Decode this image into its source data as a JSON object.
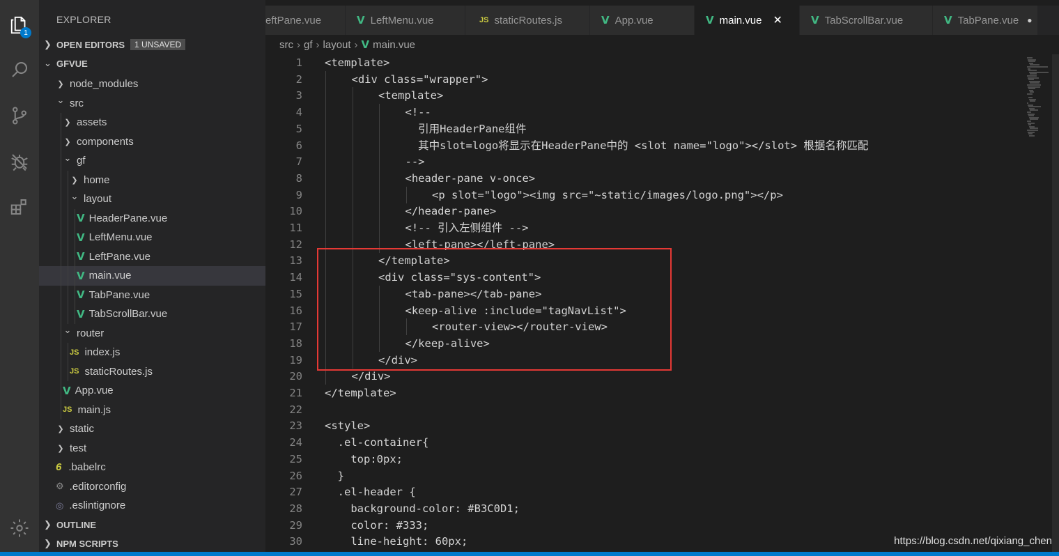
{
  "activity_bar": {
    "icons": [
      "explorer-icon",
      "search-icon",
      "source-control-icon",
      "debug-icon",
      "extensions-icon",
      "settings-gear-icon"
    ],
    "explorer_badge": "1"
  },
  "sidebar": {
    "title": "EXPLORER",
    "open_editors": {
      "label": "OPEN EDITORS",
      "badge": "1 UNSAVED"
    },
    "project": {
      "label": "GFVUE"
    },
    "tree": [
      {
        "label": "node_modules",
        "kind": "folder-closed",
        "depth": 0
      },
      {
        "label": "src",
        "kind": "folder-open",
        "depth": 0
      },
      {
        "label": "assets",
        "kind": "folder-closed",
        "depth": 1
      },
      {
        "label": "components",
        "kind": "folder-closed",
        "depth": 1
      },
      {
        "label": "gf",
        "kind": "folder-open",
        "depth": 1
      },
      {
        "label": "home",
        "kind": "folder-closed",
        "depth": 2
      },
      {
        "label": "layout",
        "kind": "folder-open",
        "depth": 2
      },
      {
        "label": "HeaderPane.vue",
        "kind": "vue",
        "depth": 3
      },
      {
        "label": "LeftMenu.vue",
        "kind": "vue",
        "depth": 3
      },
      {
        "label": "LeftPane.vue",
        "kind": "vue",
        "depth": 3
      },
      {
        "label": "main.vue",
        "kind": "vue",
        "depth": 3,
        "selected": true
      },
      {
        "label": "TabPane.vue",
        "kind": "vue",
        "depth": 3
      },
      {
        "label": "TabScrollBar.vue",
        "kind": "vue",
        "depth": 3
      },
      {
        "label": "router",
        "kind": "folder-open",
        "depth": 1
      },
      {
        "label": "index.js",
        "kind": "js",
        "depth": 2
      },
      {
        "label": "staticRoutes.js",
        "kind": "js",
        "depth": 2
      },
      {
        "label": "App.vue",
        "kind": "vue",
        "depth": 1
      },
      {
        "label": "main.js",
        "kind": "js",
        "depth": 1
      },
      {
        "label": "static",
        "kind": "folder-closed",
        "depth": 0
      },
      {
        "label": "test",
        "kind": "folder-closed",
        "depth": 0
      },
      {
        "label": ".babelrc",
        "kind": "babel",
        "depth": 0
      },
      {
        "label": ".editorconfig",
        "kind": "gear",
        "depth": 0
      },
      {
        "label": ".eslintignore",
        "kind": "eslint",
        "depth": 0
      }
    ],
    "outline": {
      "label": "OUTLINE"
    },
    "npm_scripts": {
      "label": "NPM SCRIPTS"
    }
  },
  "tabs": [
    {
      "label": "eftPane.vue",
      "kind": "vue-cut"
    },
    {
      "label": "LeftMenu.vue",
      "kind": "vue"
    },
    {
      "label": "staticRoutes.js",
      "kind": "js"
    },
    {
      "label": "App.vue",
      "kind": "vue"
    },
    {
      "label": "main.vue",
      "kind": "vue",
      "active": true,
      "close": "✕"
    },
    {
      "label": "TabScrollBar.vue",
      "kind": "vue"
    },
    {
      "label": "TabPane.vue",
      "kind": "vue",
      "unsaved": "●"
    }
  ],
  "breadcrumb": [
    "src",
    "gf",
    "layout",
    "main.vue"
  ],
  "editor": {
    "lines": [
      {
        "n": "1",
        "indent": 0,
        "text": "<template>"
      },
      {
        "n": "2",
        "indent": 1,
        "text": "<div class=\"wrapper\">"
      },
      {
        "n": "3",
        "indent": 2,
        "text": "<template>"
      },
      {
        "n": "4",
        "indent": 3,
        "text": "<!--"
      },
      {
        "n": "5",
        "indent": 3,
        "text": "  引用HeaderPane组件"
      },
      {
        "n": "6",
        "indent": 3,
        "text": "  其中slot=logo将显示在HeaderPane中的 <slot name=\"logo\"></slot> 根据名称匹配"
      },
      {
        "n": "7",
        "indent": 3,
        "text": "-->"
      },
      {
        "n": "8",
        "indent": 3,
        "text": "<header-pane v-once>"
      },
      {
        "n": "9",
        "indent": 4,
        "text": "<p slot=\"logo\"><img src=\"~static/images/logo.png\"></p>"
      },
      {
        "n": "10",
        "indent": 3,
        "text": "</header-pane>"
      },
      {
        "n": "11",
        "indent": 3,
        "text": "<!-- 引入左侧组件 -->"
      },
      {
        "n": "12",
        "indent": 3,
        "text": "<left-pane></left-pane>"
      },
      {
        "n": "13",
        "indent": 2,
        "text": "</template>"
      },
      {
        "n": "14",
        "indent": 2,
        "text": "<div class=\"sys-content\">"
      },
      {
        "n": "15",
        "indent": 3,
        "text": "<tab-pane></tab-pane>"
      },
      {
        "n": "16",
        "indent": 3,
        "text": "<keep-alive :include=\"tagNavList\">"
      },
      {
        "n": "17",
        "indent": 4,
        "text": "<router-view></router-view>"
      },
      {
        "n": "18",
        "indent": 3,
        "text": "</keep-alive>"
      },
      {
        "n": "19",
        "indent": 2,
        "text": "</div>"
      },
      {
        "n": "20",
        "indent": 1,
        "text": "</div>"
      },
      {
        "n": "21",
        "indent": 0,
        "text": "</template>"
      },
      {
        "n": "22",
        "indent": 0,
        "text": ""
      },
      {
        "n": "23",
        "indent": 0,
        "text": "<style>"
      },
      {
        "n": "24",
        "indent": 0,
        "text": "  .el-container{"
      },
      {
        "n": "25",
        "indent": 0,
        "text": "    top:0px;"
      },
      {
        "n": "26",
        "indent": 0,
        "text": "  }"
      },
      {
        "n": "27",
        "indent": 0,
        "text": "  .el-header {"
      },
      {
        "n": "28",
        "indent": 0,
        "text": "    background-color: #B3C0D1;"
      },
      {
        "n": "29",
        "indent": 0,
        "text": "    color: #333;"
      },
      {
        "n": "30",
        "indent": 0,
        "text": "    line-height: 60px;"
      }
    ]
  },
  "watermark": "https://blog.csdn.net/qixiang_chen"
}
